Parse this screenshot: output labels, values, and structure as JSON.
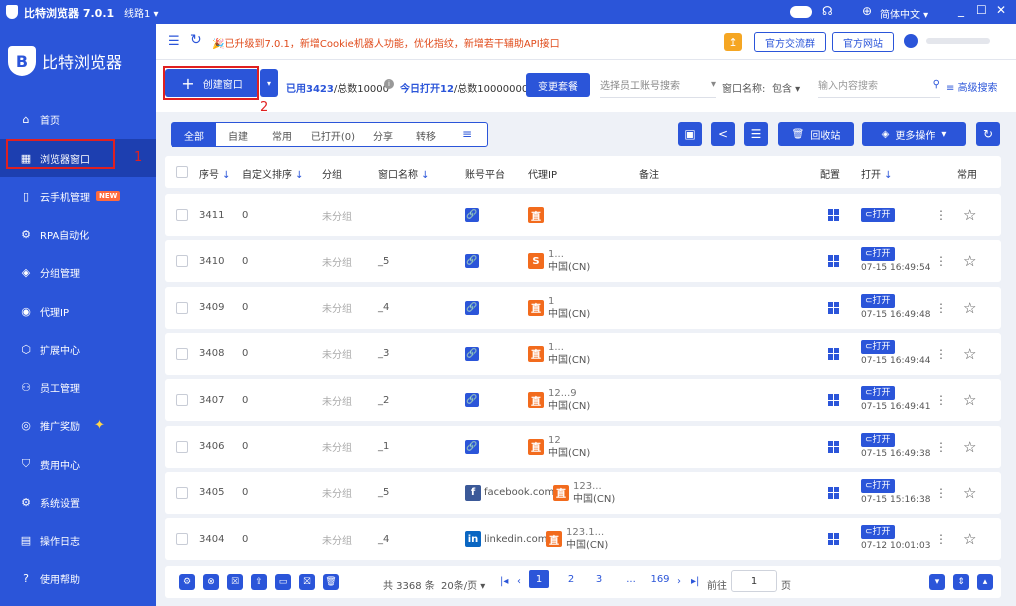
{
  "titlebar": {
    "title": "比特浏览器 7.0.1",
    "line": "线路1",
    "language": "简体中文"
  },
  "sidebar": {
    "brand": "比特浏览器",
    "items": [
      {
        "label": "首页",
        "icon": "home-icon"
      },
      {
        "label": "浏览器窗口",
        "icon": "grid-icon"
      },
      {
        "label": "云手机管理",
        "icon": "phone-icon",
        "badge": "NEW"
      },
      {
        "label": "RPA自动化",
        "icon": "robot-icon"
      },
      {
        "label": "分组管理",
        "icon": "layers-icon"
      },
      {
        "label": "代理IP",
        "icon": "location-icon"
      },
      {
        "label": "扩展中心",
        "icon": "cube-icon"
      },
      {
        "label": "员工管理",
        "icon": "users-icon"
      },
      {
        "label": "推广奖励",
        "icon": "coin-icon"
      },
      {
        "label": "费用中心",
        "icon": "shield-icon"
      },
      {
        "label": "系统设置",
        "icon": "gear-icon"
      },
      {
        "label": "操作日志",
        "icon": "log-icon"
      },
      {
        "label": "使用帮助",
        "icon": "help-icon"
      }
    ]
  },
  "topbar": {
    "notice": "🎉已升级到7.0.1，新增Cookie机器人功能，优化指纹，新增若干辅助API接口",
    "community": "官方交流群",
    "website": "官方网站"
  },
  "toolbar": {
    "create": "创建窗口",
    "used_prefix": "已用",
    "used_value": "3423",
    "used_total": "/总数10000",
    "opened_prefix": "今日打开",
    "opened_value": "12",
    "opened_total": "/总数10000000",
    "change_plan": "变更套餐",
    "staff_placeholder": "选择员工账号搜索",
    "window_name_label": "窗口名称:",
    "match_mode": "包含",
    "search_placeholder": "输入内容搜索",
    "advanced": "高级搜索"
  },
  "tabs": [
    "全部",
    "自建",
    "常用",
    "已打开(0)",
    "分享",
    "转移"
  ],
  "actions": {
    "recycle": "回收站",
    "more": "更多操作"
  },
  "columns": [
    "序号",
    "自定义排序",
    "分组",
    "窗口名称",
    "账号平台",
    "代理IP",
    "备注",
    "配置",
    "打开",
    "常用"
  ],
  "rows": [
    {
      "seq": "3411",
      "sort": "0",
      "group": "未分组",
      "name": "",
      "platform": "",
      "proxy_tag": "直",
      "proxy_color": "#f26b1d",
      "ip": "",
      "loc": "",
      "open": "打开",
      "time": ""
    },
    {
      "seq": "3410",
      "sort": "0",
      "group": "未分组",
      "name": "_5",
      "platform": "",
      "proxy_tag": "S",
      "proxy_color": "#f26b1d",
      "ip": "1...",
      "loc": "中国(CN)",
      "open": "打开",
      "time": "07-15 16:49:54"
    },
    {
      "seq": "3409",
      "sort": "0",
      "group": "未分组",
      "name": "_4",
      "platform": "",
      "proxy_tag": "直",
      "proxy_color": "#f26b1d",
      "ip": "1",
      "loc": "中国(CN)",
      "open": "打开",
      "time": "07-15 16:49:48"
    },
    {
      "seq": "3408",
      "sort": "0",
      "group": "未分组",
      "name": "_3",
      "platform": "",
      "proxy_tag": "直",
      "proxy_color": "#f26b1d",
      "ip": "1...",
      "loc": "中国(CN)",
      "open": "打开",
      "time": "07-15 16:49:44"
    },
    {
      "seq": "3407",
      "sort": "0",
      "group": "未分组",
      "name": "_2",
      "platform": "",
      "proxy_tag": "直",
      "proxy_color": "#f26b1d",
      "ip": "12...9",
      "loc": "中国(CN)",
      "open": "打开",
      "time": "07-15 16:49:41"
    },
    {
      "seq": "3406",
      "sort": "0",
      "group": "未分组",
      "name": "_1",
      "platform": "",
      "proxy_tag": "直",
      "proxy_color": "#f26b1d",
      "ip": "12",
      "loc": "中国(CN)",
      "open": "打开",
      "time": "07-15 16:49:38"
    },
    {
      "seq": "3405",
      "sort": "0",
      "group": "未分组",
      "name": "_5",
      "platform": "facebook.com",
      "proxy_tag": "直",
      "proxy_color": "#f26b1d",
      "ip": "123...",
      "loc": "中国(CN)",
      "open": "打开",
      "time": "07-15 15:16:38"
    },
    {
      "seq": "3404",
      "sort": "0",
      "group": "未分组",
      "name": "_4",
      "platform": "linkedin.com",
      "proxy_tag": "直",
      "proxy_color": "#f26b1d",
      "ip": "123.1...",
      "loc": "中国(CN)",
      "open": "打开",
      "time": "07-12 10:01:03"
    }
  ],
  "pagination": {
    "total": "共 3368 条",
    "per_page": "20条/页",
    "pages": [
      "1",
      "2",
      "3",
      "...",
      "169"
    ],
    "goto_label": "前往",
    "goto_value": "1",
    "page_suffix": "页"
  },
  "annotations": {
    "one": "1",
    "two": "2"
  },
  "colors": {
    "primary": "#2b55d9",
    "orange": "#f26b1d",
    "red": "#e02020"
  }
}
